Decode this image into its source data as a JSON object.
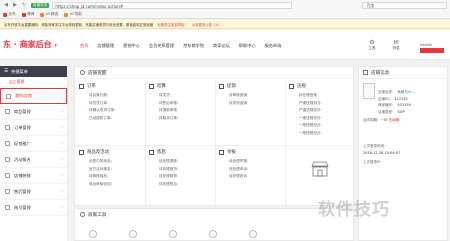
{
  "browser": {
    "secure_label": "百度安全",
    "url": "https://shop.jd.com/index.action#",
    "search_value": "百度",
    "bookmarks": [
      {
        "label": "京东"
      },
      {
        "label": "微博"
      },
      {
        "label": "UC精选"
      },
      {
        "label": "UC导航"
      }
    ]
  },
  "notice": {
    "text": "京东开放平台重要通知：请各商家关注平台规则更新，完善店铺资质与安全设置，避免影响正常经营",
    "warning": "近期关注安全风险！",
    "more": "以及更多公告（5）"
  },
  "header": {
    "logo": "东 · 商家后台",
    "nav": [
      "首页",
      "店铺管理",
      "营销中心",
      "会员关系管理",
      "京东商学院",
      "商家论坛",
      "帮助中心",
      "服务市场"
    ],
    "tools": [
      {
        "icon": "gear-icon",
        "label": "工具"
      },
      {
        "icon": "bell-icon",
        "label": "消息"
      }
    ],
    "user_name": "hendo"
  },
  "sidebar": {
    "heading": "快捷菜单",
    "sub": "店工管理",
    "items": [
      "我的店铺",
      "商品管理",
      "订单管理",
      "促销推广",
      "活动报名",
      "店铺装修",
      "售后管理",
      "账号管理"
    ]
  },
  "main": {
    "title": "店铺提醒",
    "sections": [
      {
        "title": "订单",
        "rows": [
          "待买家付款：",
          "待发货订单：",
          "待确认收货订单：",
          "已经退款订单："
        ]
      },
      {
        "title": "结算",
        "rows": [
          "待发货：",
          "待售后审核：",
          "待退款审核：",
          "待取消订单："
        ]
      },
      {
        "title": "促销",
        "rows": [
          "待审核促销：",
          "待发布促销："
        ]
      },
      {
        "title": "违规",
        "rows": [
          "待处理违规：",
          "严重违规扣分：",
          "严重违规扣分：",
          "一般违规扣分：",
          "一般违规扣分：",
          "一般违规扣分："
        ]
      },
      {
        "title": "商品及活动",
        "rows": [
          "出售中的商品：",
          "官方活动报名：",
          "待审核商品：",
          "商品审核驳回："
        ]
      },
      {
        "title": "售后",
        "rows": [
          "待处理退款：",
          "待处理换货：",
          "待处理维修：",
          "待处理售后："
        ]
      },
      {
        "title": "举报",
        "rows": [
          "待处理举报：",
          "待处理申诉：",
          "待处理投诉："
        ]
      }
    ]
  },
  "tools_panel": {
    "title": "商家工具"
  },
  "right": {
    "title": "店铺信息",
    "shop_name_label": "店铺名称：",
    "shop_name": "秋枫与小...",
    "shop_id_label": "店铺ID：",
    "shop_id": "527155",
    "vendor_label": "商家编号：",
    "vendor": "521159",
    "type_label": "店铺类型：",
    "type": "SOP",
    "deadline_label": "合同到期：",
    "deadline": "一年 ",
    "renew": "去续期",
    "last_login_label": "上次登录时间：",
    "last_login": "2016-12-28 10:04:57",
    "last_ip_label": "上次登录IP："
  },
  "watermark": "软件技巧"
}
